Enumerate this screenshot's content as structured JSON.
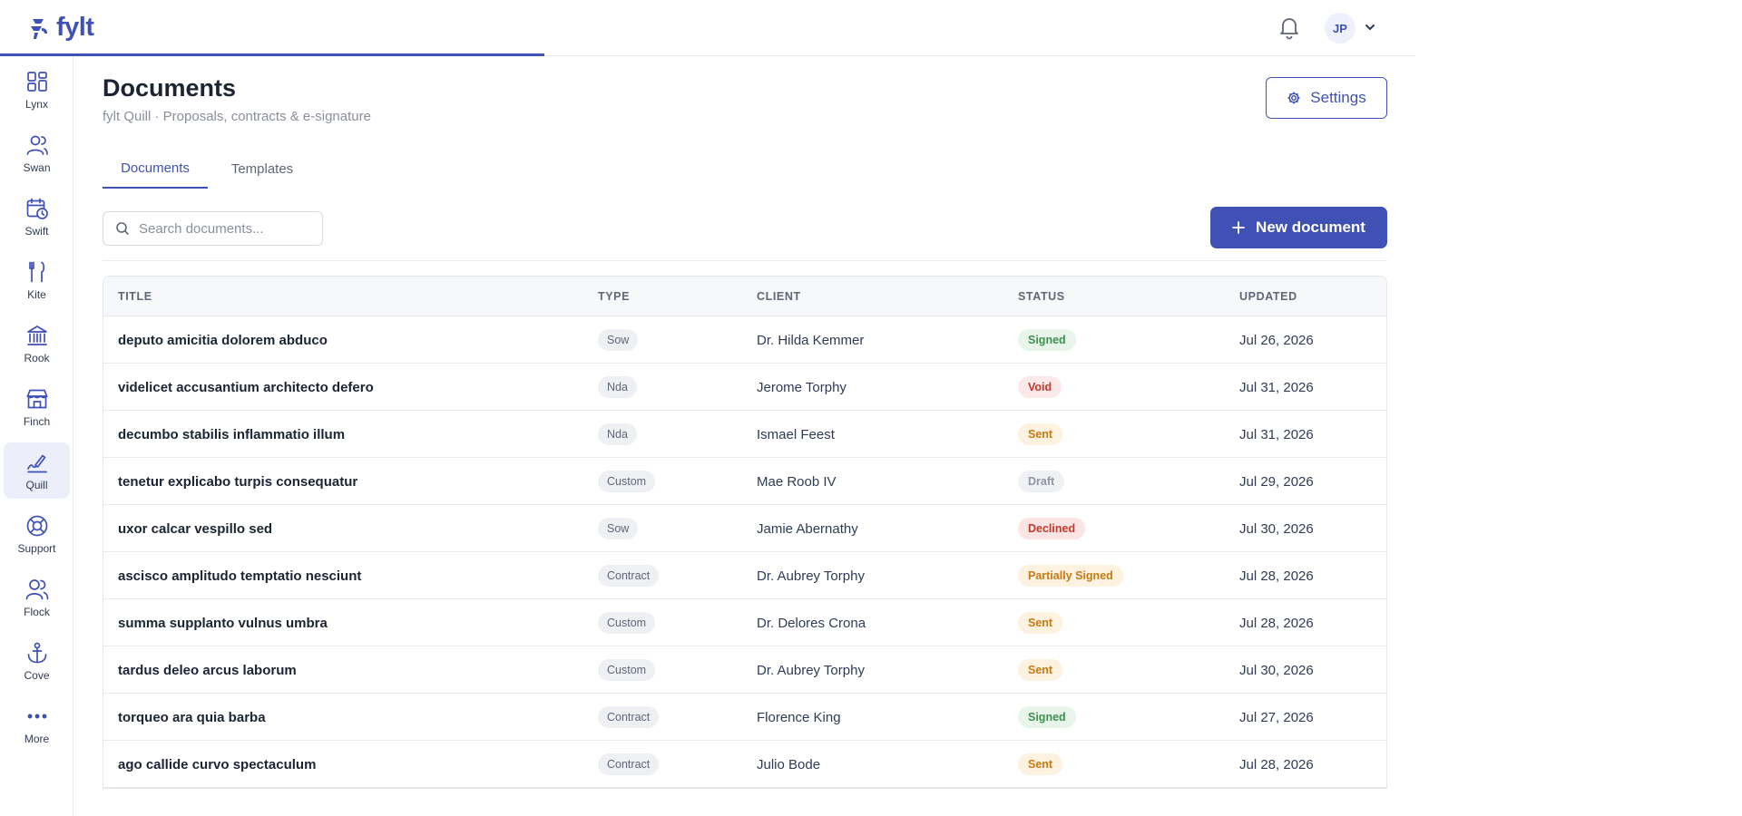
{
  "brand": {
    "name": "fylt",
    "color": "#3f51b5"
  },
  "header": {
    "avatar_initials": "JP"
  },
  "sidebar": {
    "items": [
      {
        "label": "Lynx",
        "icon": "dashboard-grid-icon",
        "active": false
      },
      {
        "label": "Swan",
        "icon": "users-icon",
        "active": false
      },
      {
        "label": "Swift",
        "icon": "calendar-clock-icon",
        "active": false
      },
      {
        "label": "Kite",
        "icon": "fork-knife-icon",
        "active": false
      },
      {
        "label": "Rook",
        "icon": "bank-icon",
        "active": false
      },
      {
        "label": "Finch",
        "icon": "storefront-icon",
        "active": false
      },
      {
        "label": "Quill",
        "icon": "signature-icon",
        "active": true
      },
      {
        "label": "Support",
        "icon": "lifebuoy-icon",
        "active": false
      },
      {
        "label": "Flock",
        "icon": "group-icon",
        "active": false
      },
      {
        "label": "Cove",
        "icon": "anchor-icon",
        "active": false
      },
      {
        "label": "More",
        "icon": "more-dots-icon",
        "active": false
      }
    ]
  },
  "page": {
    "title": "Documents",
    "subtitle": "fylt Quill · Proposals, contracts & e-signature",
    "settings_label": "Settings",
    "new_button_label": "New document",
    "search_placeholder": "Search documents..."
  },
  "tabs": [
    {
      "label": "Documents",
      "active": true
    },
    {
      "label": "Templates",
      "active": false
    }
  ],
  "table": {
    "columns": [
      "TITLE",
      "TYPE",
      "CLIENT",
      "STATUS",
      "UPDATED"
    ],
    "rows": [
      {
        "title": "deputo amicitia dolorem abduco",
        "type": "Sow",
        "client": "Dr. Hilda Kemmer",
        "status": "Signed",
        "updated": "Jul 26, 2026"
      },
      {
        "title": "videlicet accusantium architecto defero",
        "type": "Nda",
        "client": "Jerome Torphy",
        "status": "Void",
        "updated": "Jul 31, 2026"
      },
      {
        "title": "decumbo stabilis inflammatio illum",
        "type": "Nda",
        "client": "Ismael Feest",
        "status": "Sent",
        "updated": "Jul 31, 2026"
      },
      {
        "title": "tenetur explicabo turpis consequatur",
        "type": "Custom",
        "client": "Mae Roob IV",
        "status": "Draft",
        "updated": "Jul 29, 2026"
      },
      {
        "title": "uxor calcar vespillo sed",
        "type": "Sow",
        "client": "Jamie Abernathy",
        "status": "Declined",
        "updated": "Jul 30, 2026"
      },
      {
        "title": "ascisco amplitudo temptatio nesciunt",
        "type": "Contract",
        "client": "Dr. Aubrey Torphy",
        "status": "Partially Signed",
        "updated": "Jul 28, 2026"
      },
      {
        "title": "summa supplanto vulnus umbra",
        "type": "Custom",
        "client": "Dr. Delores Crona",
        "status": "Sent",
        "updated": "Jul 28, 2026"
      },
      {
        "title": "tardus deleo arcus laborum",
        "type": "Custom",
        "client": "Dr. Aubrey Torphy",
        "status": "Sent",
        "updated": "Jul 30, 2026"
      },
      {
        "title": "torqueo ara quia barba",
        "type": "Contract",
        "client": "Florence King",
        "status": "Signed",
        "updated": "Jul 27, 2026"
      },
      {
        "title": "ago callide curvo spectaculum",
        "type": "Contract",
        "client": "Julio Bode",
        "status": "Sent",
        "updated": "Jul 28, 2026"
      }
    ]
  },
  "status_colors": {
    "Signed": {
      "bg": "#e7f5ea",
      "fg": "#3f8f4f"
    },
    "Void": {
      "bg": "#fbe9e9",
      "fg": "#c0392b"
    },
    "Sent": {
      "bg": "#fdf1df",
      "fg": "#c77a12"
    },
    "Draft": {
      "bg": "#f0f1f4",
      "fg": "#9096a3"
    },
    "Declined": {
      "bg": "#fbe4e4",
      "fg": "#c0392b"
    },
    "Partially Signed": {
      "bg": "#fdf1df",
      "fg": "#c77a12"
    }
  }
}
